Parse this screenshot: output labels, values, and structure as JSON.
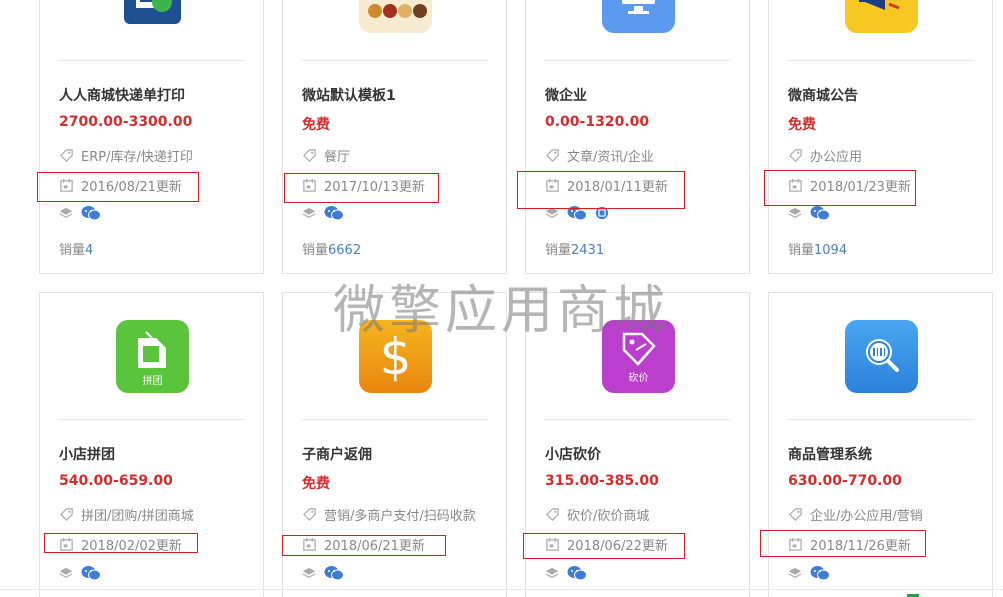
{
  "watermark": "微擎应用商城",
  "colors": {
    "price": "#d52c2c",
    "sales_number": "#4a7fc1",
    "highlight_box": "#d81e1e"
  },
  "apps": [
    {
      "name": "人人商城快递单打印",
      "price": "2700.00-3300.00",
      "tags": "ERP/库存/快递打印",
      "updated": "2016/08/21更新",
      "sales_label": "销量",
      "sales_count": "4",
      "icon": "print-app-icon",
      "platforms": [
        "layers-icon",
        "wechat-icon"
      ]
    },
    {
      "name": "微站默认模板1",
      "price": "免费",
      "tags": "餐厅",
      "updated": "2017/10/13更新",
      "sales_label": "销量",
      "sales_count": "6662",
      "icon": "food-template-icon",
      "platforms": [
        "layers-icon",
        "wechat-icon"
      ]
    },
    {
      "name": "微企业",
      "price": "0.00-1320.00",
      "tags": "文章/资讯/企业",
      "updated": "2018/01/11更新",
      "sales_label": "销量",
      "sales_count": "2431",
      "icon": "monitor-icon",
      "platforms": [
        "layers-icon",
        "wechat-icon",
        "miniprogram-icon"
      ]
    },
    {
      "name": "微商城公告",
      "price": "免费",
      "tags": "办公应用",
      "updated": "2018/01/23更新",
      "sales_label": "销量",
      "sales_count": "1094",
      "icon": "megaphone-icon",
      "platforms": [
        "layers-icon",
        "wechat-icon"
      ]
    },
    {
      "name": "小店拼团",
      "price": "540.00-659.00",
      "tags": "拼团/团购/拼团商城",
      "updated": "2018/02/02更新",
      "icon": "group-buy-icon",
      "icon_label": "拼团",
      "platforms": [
        "layers-icon",
        "wechat-icon"
      ]
    },
    {
      "name": "子商户返佣",
      "price": "免费",
      "tags": "营销/多商户支付/扫码收款",
      "updated": "2018/06/21更新",
      "icon": "dollar-icon",
      "platforms": [
        "layers-icon",
        "wechat-icon"
      ]
    },
    {
      "name": "小店砍价",
      "price": "315.00-385.00",
      "tags": "砍价/砍价商城",
      "updated": "2018/06/22更新",
      "icon": "bargain-icon",
      "icon_label": "砍价",
      "platforms": [
        "layers-icon",
        "wechat-icon"
      ]
    },
    {
      "name": "商品管理系统",
      "price": "630.00-770.00",
      "tags": "企业/办公应用/营销",
      "updated": "2018/11/26更新",
      "icon": "barcode-search-icon",
      "platforms": [
        "layers-icon",
        "wechat-icon"
      ]
    }
  ]
}
